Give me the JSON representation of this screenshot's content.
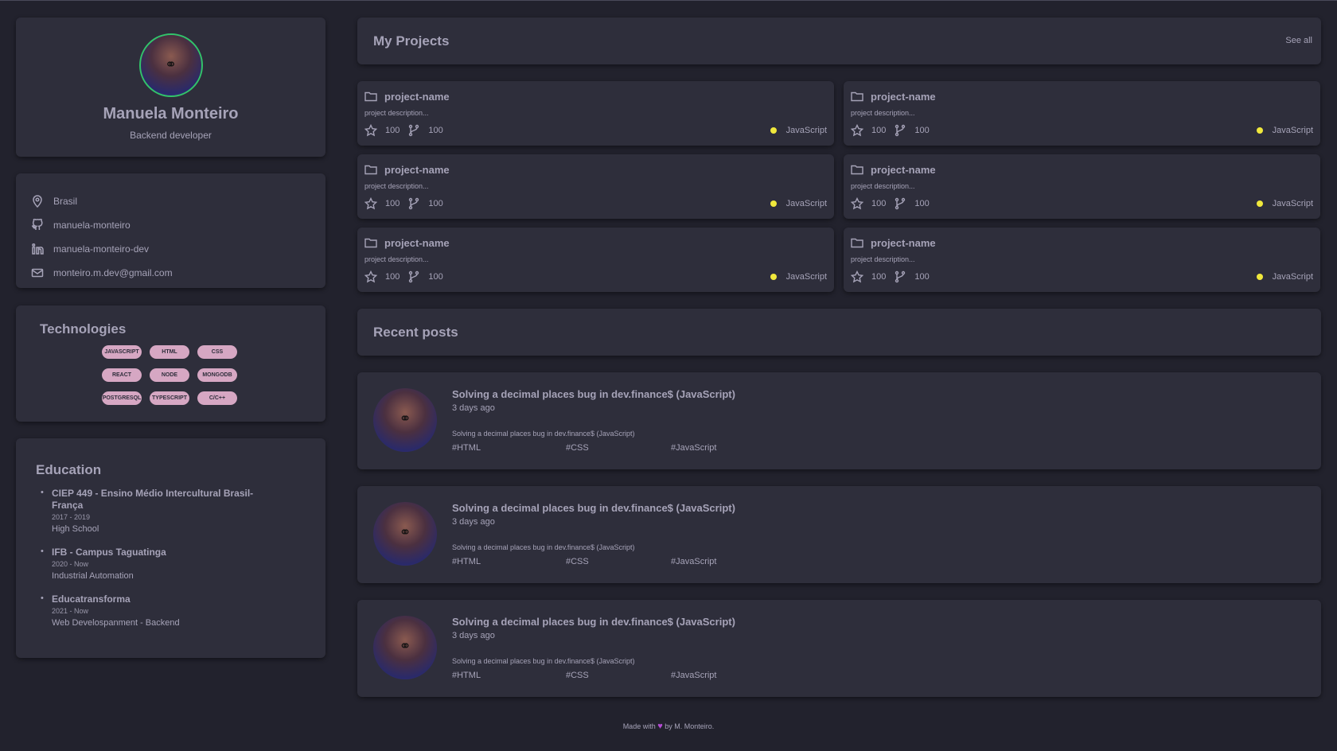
{
  "profile": {
    "name": "Manuela Monteiro",
    "role": "Backend developer"
  },
  "contact": {
    "location": "Brasil",
    "github": "manuela-monteiro",
    "linkedin": "manuela-monteiro-dev",
    "email": "monteiro.m.dev@gmail.com"
  },
  "technologies": {
    "title": "Technologies",
    "items": [
      "JAVASCRIPT",
      "HTML",
      "CSS",
      "REACT",
      "NODE",
      "MONGODB",
      "POSTGRESQL",
      "TYPESCRIPT",
      "C/C++"
    ]
  },
  "education": {
    "title": "Education",
    "items": [
      {
        "school": "CIEP 449 - Ensino Médio Intercultural Brasil-França",
        "dates": "2017 - 2019",
        "course": "High School"
      },
      {
        "school": "IFB - Campus Taguatinga",
        "dates": "2020 - Now",
        "course": "Industrial Automation"
      },
      {
        "school": "Educatransforma",
        "dates": "2021 - Now",
        "course": "Web Develospanment - Backend"
      }
    ]
  },
  "projects": {
    "title": "My Projects",
    "see_all": "See all",
    "items": [
      {
        "name": "project-name",
        "description": "project description...",
        "stars": "100",
        "forks": "100",
        "language": "JavaScript",
        "language_color": "#f0e83c"
      },
      {
        "name": "project-name",
        "description": "project description...",
        "stars": "100",
        "forks": "100",
        "language": "JavaScript",
        "language_color": "#f0e83c"
      },
      {
        "name": "project-name",
        "description": "project description...",
        "stars": "100",
        "forks": "100",
        "language": "JavaScript",
        "language_color": "#f0e83c"
      },
      {
        "name": "project-name",
        "description": "project description...",
        "stars": "100",
        "forks": "100",
        "language": "JavaScript",
        "language_color": "#f0e83c"
      },
      {
        "name": "project-name",
        "description": "project description...",
        "stars": "100",
        "forks": "100",
        "language": "JavaScript",
        "language_color": "#f0e83c"
      },
      {
        "name": "project-name",
        "description": "project description...",
        "stars": "100",
        "forks": "100",
        "language": "JavaScript",
        "language_color": "#f0e83c"
      }
    ]
  },
  "posts": {
    "title": "Recent posts",
    "items": [
      {
        "title": "Solving a decimal places bug in dev.finance$ (JavaScript)",
        "time": "3 days ago",
        "excerpt": "Solving a decimal places bug in dev.finance$ (JavaScript)",
        "tags": [
          "#HTML",
          "#CSS",
          "#JavaScript"
        ]
      },
      {
        "title": "Solving a decimal places bug in dev.finance$ (JavaScript)",
        "time": "3 days ago",
        "excerpt": "Solving a decimal places bug in dev.finance$ (JavaScript)",
        "tags": [
          "#HTML",
          "#CSS",
          "#JavaScript"
        ]
      },
      {
        "title": "Solving a decimal places bug in dev.finance$ (JavaScript)",
        "time": "3 days ago",
        "excerpt": "Solving a decimal places bug in dev.finance$ (JavaScript)",
        "tags": [
          "#HTML",
          "#CSS",
          "#JavaScript"
        ]
      }
    ]
  },
  "footer": {
    "prefix": "Made with",
    "suffix": "by M. Monteiro."
  },
  "colors": {
    "background": "#22222d",
    "card": "#2e2e3b",
    "text": "#a6a3b8",
    "badge": "#d6a7c3",
    "avatar_ring": "#32c36a",
    "heart": "#b44bd4"
  }
}
